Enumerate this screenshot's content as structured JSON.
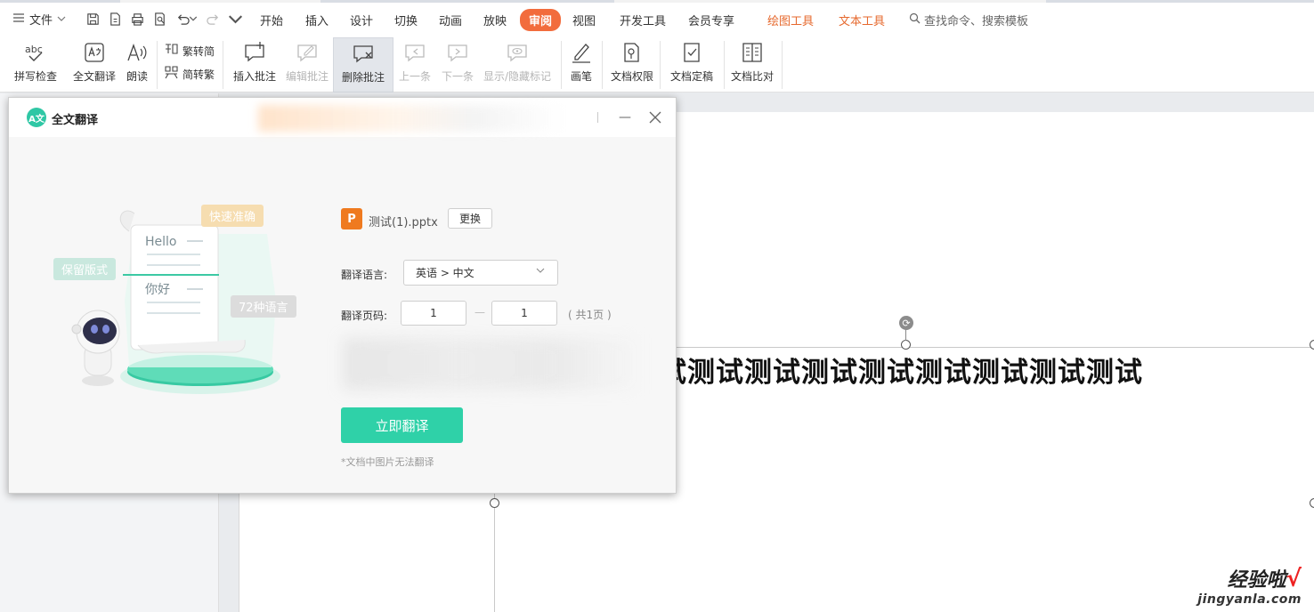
{
  "menubar": {
    "file_label": "文件",
    "tabs": [
      "开始",
      "插入",
      "设计",
      "切换",
      "动画",
      "放映",
      "审阅",
      "视图",
      "开发工具",
      "会员专享",
      "绘图工具",
      "文本工具"
    ],
    "active_tab": "审阅",
    "search_placeholder": "查找命令、搜索模板"
  },
  "ribbon": {
    "spell_check": "拼写检查",
    "spell_icon_text": "abc",
    "full_translate": "全文翻译",
    "read_aloud": "朗读",
    "trad_to_simp": "繁转简",
    "simp_to_trad": "简转繁",
    "insert_comment": "插入批注",
    "edit_comment": "编辑批注",
    "delete_comment": "删除批注",
    "prev": "上一条",
    "next": "下一条",
    "show_hide_marks": "显示/隐藏标记",
    "pen": "画笔",
    "doc_permission": "文档权限",
    "doc_finalize": "文档定稿",
    "doc_compare": "文档比对"
  },
  "slide": {
    "text": "试测试测试测试测试测试测试测试测试"
  },
  "watermark": {
    "cn": "经验啦",
    "check": "√",
    "en": "jingyanla.com"
  },
  "dialog": {
    "title": "全文翻译",
    "min_glyph": "—",
    "illustration": {
      "tag_fast": "快速准确",
      "tag_layout": "保留版式",
      "tag_langs": "72种语言",
      "doc_hello": "Hello",
      "doc_nihao": "你好"
    },
    "file_icon_letter": "P",
    "file_name": "测试(1).pptx",
    "change_button": "更换",
    "language_label": "翻译语言:",
    "language_value": "英语 > 中文",
    "pages_label": "翻译页码:",
    "page_from": "1",
    "page_to": "1",
    "page_dash": "—",
    "page_total": "( 共1页 )",
    "translate_button": "立即翻译",
    "note": "*文档中图片无法翻译"
  },
  "colors": {
    "accent_tab": "#f26c3d",
    "translate_button": "#2fd1a8",
    "file_icon": "#ef7a1f",
    "tool_tabs": "#e6692e"
  }
}
